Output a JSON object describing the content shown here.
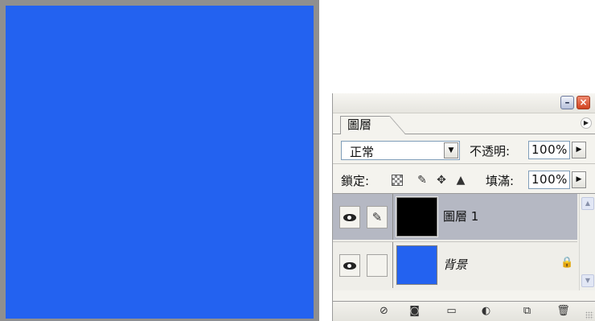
{
  "canvas": {
    "color": "#2362f0"
  },
  "panel": {
    "tab_label": "圖層",
    "blend_mode": "正常",
    "opacity_label": "不透明:",
    "opacity_value": "100%",
    "lock_label": "鎖定:",
    "fill_label": "填滿:",
    "fill_value": "100%",
    "layers": [
      {
        "name": "圖層 1",
        "thumb_color": "#000000",
        "selected": true
      },
      {
        "name": "背景",
        "thumb_color": "#2362f0",
        "locked": true
      }
    ],
    "bottom_icons": [
      "link-layers-icon",
      "layer-style-icon",
      "layer-mask-icon",
      "new-group-icon",
      "adjustment-layer-icon",
      "new-layer-icon",
      "trash-icon"
    ]
  }
}
